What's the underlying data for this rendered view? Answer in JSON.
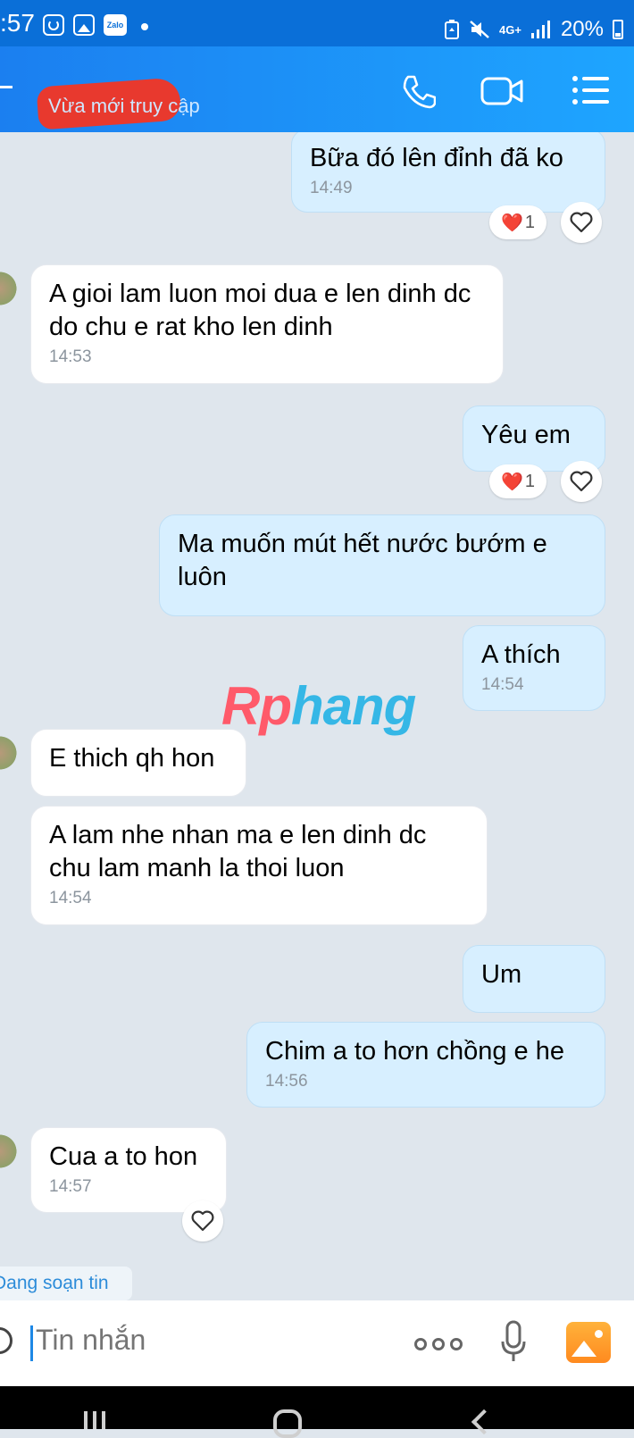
{
  "status_bar": {
    "time": ":57",
    "network": "4G+",
    "battery": "20%",
    "icons": [
      "face-icon",
      "gallery-icon",
      "zalo-icon",
      "dot-icon",
      "battery-saver-icon",
      "mute-icon",
      "signal-icon",
      "battery-icon"
    ]
  },
  "header": {
    "contact_status": "Vừa mới truy cập",
    "icons": [
      "back-icon",
      "phone-icon",
      "video-call-icon",
      "menu-icon"
    ]
  },
  "messages": [
    {
      "sender": "me",
      "text": "Bữa đó lên đỉnh đã ko",
      "time": "14:49",
      "reaction": {
        "emoji": "❤️",
        "count": "1"
      }
    },
    {
      "sender": "them",
      "text": "A gioi lam luon moi dua e len dinh dc do chu e rat kho len dinh",
      "time": "14:53"
    },
    {
      "sender": "me",
      "text": "Yêu em",
      "reaction": {
        "emoji": "❤️",
        "count": "1"
      }
    },
    {
      "sender": "me",
      "text": "Ma muốn mút hết nước bướm e luôn"
    },
    {
      "sender": "me",
      "text": "A thích",
      "time": "14:54"
    },
    {
      "sender": "them",
      "text": "E thich qh hon"
    },
    {
      "sender": "them",
      "text": "A lam nhe nhan ma e len dinh dc chu lam manh la thoi luon",
      "time": "14:54"
    },
    {
      "sender": "me",
      "text": "Um"
    },
    {
      "sender": "me",
      "text": "Chim a to hơn chồng e he",
      "time": "14:56"
    },
    {
      "sender": "them",
      "text": "Cua a to hon",
      "time": "14:57"
    }
  ],
  "watermark": {
    "part1": "Rp",
    "part2": "hang"
  },
  "typing_indicator": "Đang soạn tin",
  "composer": {
    "placeholder": "Tin nhắn"
  },
  "colors": {
    "header_blue": "#1b8cf5",
    "my_bubble": "#d7efff",
    "their_bubble": "#ffffff",
    "background": "#dfe6ed",
    "heart": "#e8283b"
  }
}
